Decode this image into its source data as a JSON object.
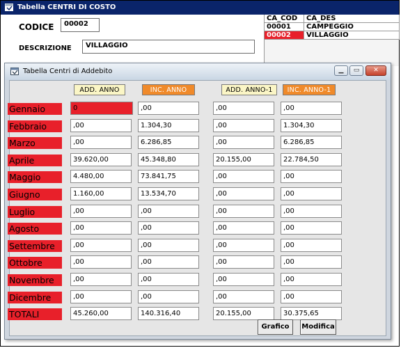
{
  "back_window": {
    "title": "Tabella CENTRI DI COSTO",
    "codice_label": "CODICE",
    "codice_value": "00002",
    "descrizione_label": "DESCRIZIONE",
    "descrizione_value": "VILLAGGIO",
    "grid": {
      "headers": [
        "CA_COD",
        "CA_DES"
      ],
      "rows": [
        [
          "00001",
          "CAMPEGGIO"
        ],
        [
          "00002",
          "VILLAGGIO"
        ]
      ]
    }
  },
  "front_window": {
    "title": "Tabella  Centri di Addebito",
    "columns": [
      "ADD. ANNO",
      "INC. ANNO",
      "ADD. ANNO-1",
      "INC. ANNO-1"
    ],
    "months": [
      {
        "label": "Gennaio",
        "values": [
          "0",
          ",00",
          ",00",
          ",00"
        ]
      },
      {
        "label": "Febbraio",
        "values": [
          ",00",
          "1.304,30",
          ",00",
          "1.304,30"
        ]
      },
      {
        "label": "Marzo",
        "values": [
          ",00",
          "6.286,85",
          ",00",
          "6.286,85"
        ]
      },
      {
        "label": "Aprile",
        "values": [
          "39.620,00",
          "45.348,80",
          "20.155,00",
          "22.784,50"
        ]
      },
      {
        "label": "Maggio",
        "values": [
          "4.480,00",
          "73.841,75",
          ",00",
          ",00"
        ]
      },
      {
        "label": "Giugno",
        "values": [
          "1.160,00",
          "13.534,70",
          ",00",
          ",00"
        ]
      },
      {
        "label": "Luglio",
        "values": [
          ",00",
          ",00",
          ",00",
          ",00"
        ]
      },
      {
        "label": "Agosto",
        "values": [
          ",00",
          ",00",
          ",00",
          ",00"
        ]
      },
      {
        "label": "Settembre",
        "values": [
          ",00",
          ",00",
          ",00",
          ",00"
        ]
      },
      {
        "label": "Ottobre",
        "values": [
          ",00",
          ",00",
          ",00",
          ",00"
        ]
      },
      {
        "label": "Novembre",
        "values": [
          ",00",
          ",00",
          ",00",
          ",00"
        ]
      },
      {
        "label": "Dicembre",
        "values": [
          ",00",
          ",00",
          ",00",
          ",00"
        ]
      },
      {
        "label": "TOTALI",
        "values": [
          "45.260,00",
          "140.316,40",
          "20.155,00",
          "30.375,65"
        ]
      }
    ],
    "buttons": {
      "grafico": "Grafico",
      "modifica": "Modifica"
    }
  },
  "colors": {
    "month_label_bg": "#e8202a",
    "header_yellow": "#fbf6c6",
    "header_orange": "#f08a2a",
    "back_title_bar": "#0a246a"
  },
  "icons": [
    "window-icon",
    "minimize-icon",
    "maximize-icon",
    "close-icon"
  ]
}
